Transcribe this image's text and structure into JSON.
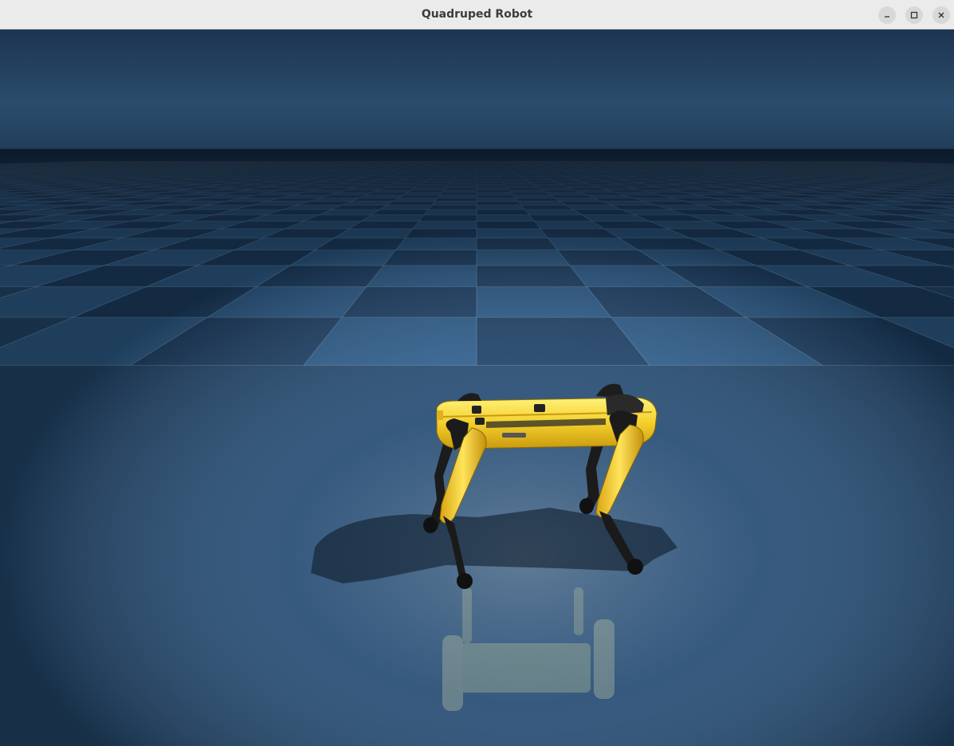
{
  "window": {
    "title": "Quadruped Robot",
    "controls": [
      "minimize",
      "maximize",
      "close"
    ]
  },
  "scene": {
    "description_type": "3d-simulation-viewport",
    "robot_color": "#f4cf2a",
    "floor_colors": [
      "#2f5f8e",
      "#1d4066",
      "#9ec2dc"
    ],
    "sky_color": "#2b4a68"
  }
}
